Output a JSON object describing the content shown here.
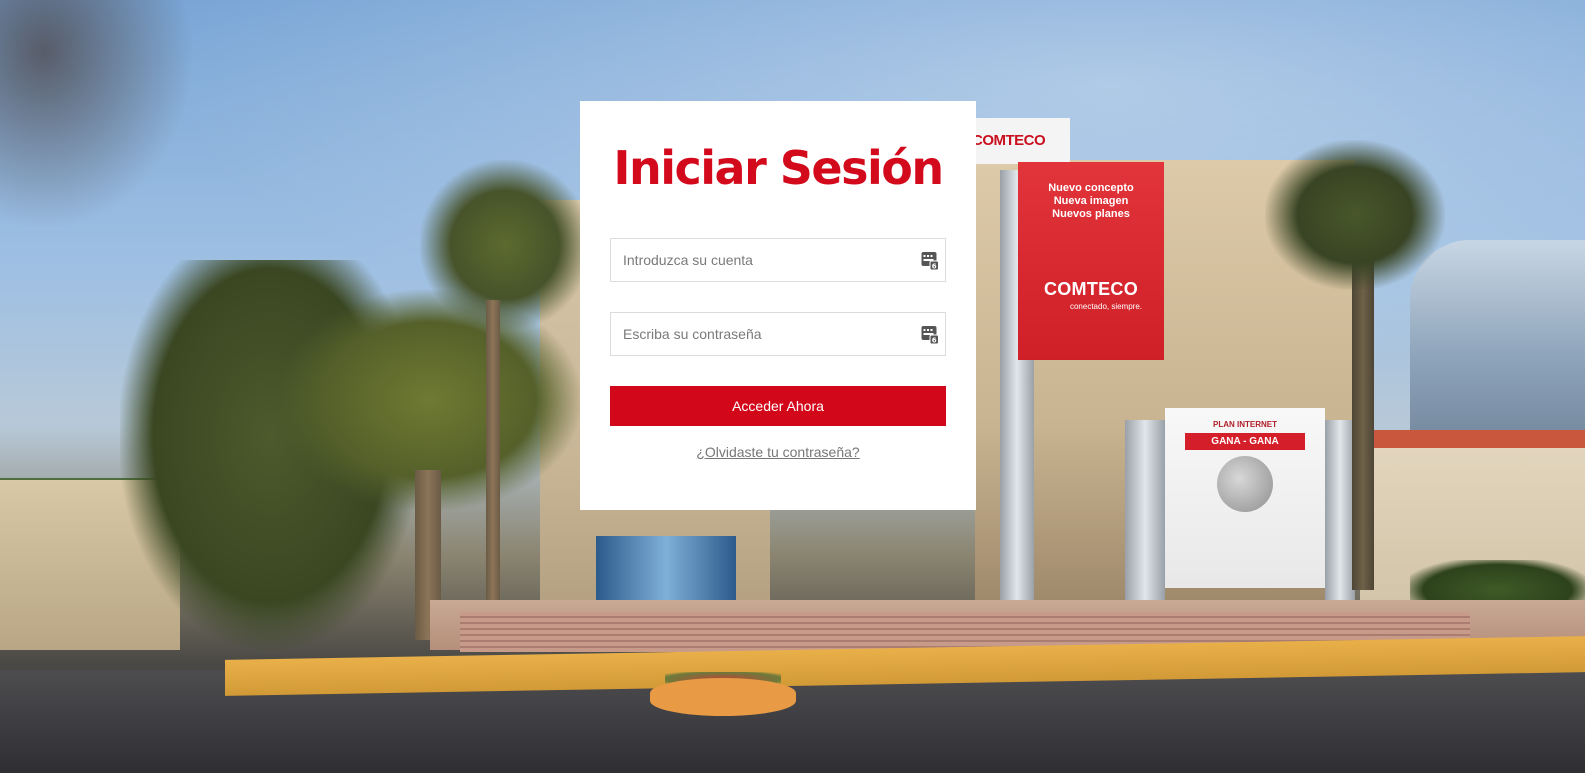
{
  "login": {
    "title": "Iniciar Sesión",
    "account_placeholder": "Introduzca su cuenta",
    "account_value": "",
    "password_placeholder": "Escriba su contraseña",
    "password_value": "",
    "submit_label": "Acceder Ahora",
    "forgot_label": "¿Olvidaste tu contraseña?",
    "field_icon": "keyboard-icon"
  },
  "background": {
    "building_sign": "COMTECO",
    "banner_red_lines": "Nuevo concepto\nNueva imagen\nNuevos planes",
    "banner_red_logo": "COMTECO",
    "banner_red_tag": "conectado, siempre.",
    "banner_white_title": "PLAN INTERNET",
    "banner_white_ribbon": "GANA - GANA"
  },
  "colors": {
    "brand_red": "#d3091c",
    "button_red": "#d2071a",
    "card_background": "#ffffff"
  }
}
